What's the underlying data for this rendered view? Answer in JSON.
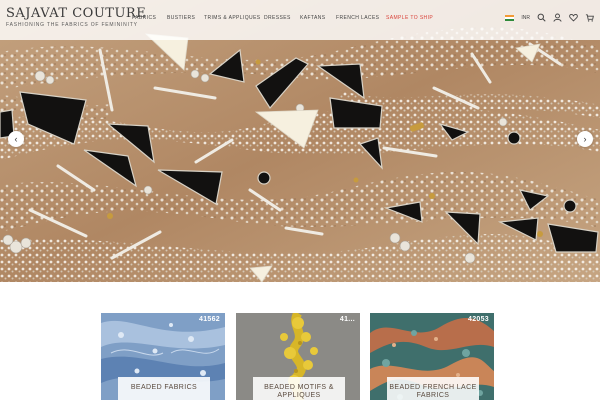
{
  "brand": {
    "name": "SAJAVAT COUTURE",
    "tagline": "FASHIONING THE FABRICS OF FEMININITY"
  },
  "nav": {
    "items": [
      {
        "label": "FABRICS"
      },
      {
        "label": "BUSTIERS"
      },
      {
        "label": "TRIMS & APPLIQUES"
      },
      {
        "label": "DRESSES"
      },
      {
        "label": "KAFTANS"
      },
      {
        "label": "FRENCH LACES"
      },
      {
        "label": "SAMPLE TO SHIP"
      }
    ],
    "sale_color": "#d9433a"
  },
  "utilities": {
    "currency": "INR",
    "icons": [
      "india-flag-icon",
      "search-icon",
      "user-icon",
      "heart-icon",
      "cart-icon"
    ]
  },
  "hero": {
    "prev_icon": "‹",
    "next_icon": "›"
  },
  "categories": [
    {
      "code": "41562",
      "label": "BEADED FABRICS"
    },
    {
      "code": "41...",
      "label": "BEADED MOTIFS & APPLIQUES"
    },
    {
      "code": "42053",
      "label": "BEADED FRENCH LACE FABRICS"
    }
  ]
}
